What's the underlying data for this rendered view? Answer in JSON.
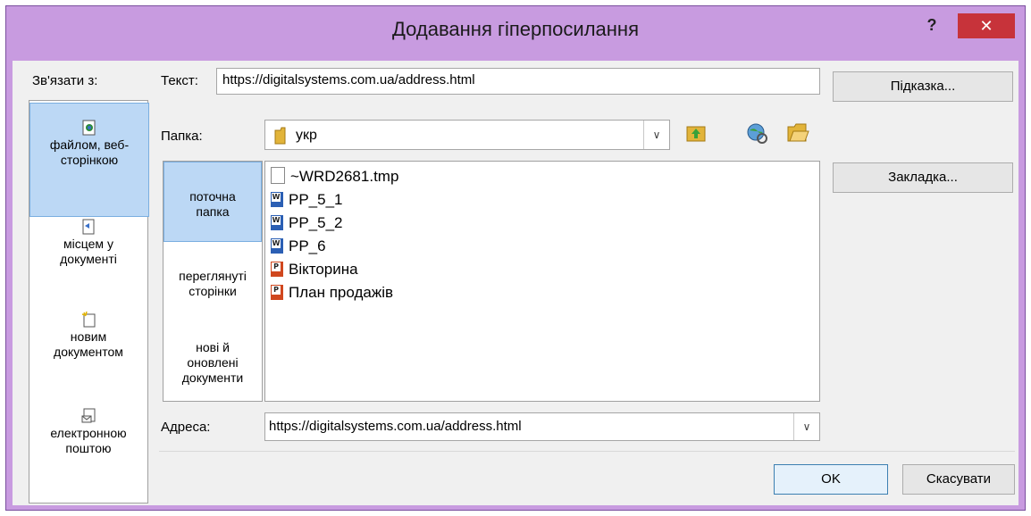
{
  "window": {
    "title": "Додавання гіперпосилання",
    "help_label": "?",
    "close_label": "✕"
  },
  "link_to": {
    "label": "Зв'язати з:",
    "items": [
      {
        "line1": "файлом, веб-",
        "line2": "сторінкою",
        "icon": "file-web-icon",
        "selected": true
      },
      {
        "line1": "місцем у",
        "line2": "документі",
        "icon": "place-in-document-icon",
        "selected": false
      },
      {
        "line1": "новим",
        "line2": "документом",
        "icon": "new-document-icon",
        "selected": false
      },
      {
        "line1": "електронною",
        "line2": "поштою",
        "icon": "email-icon",
        "selected": false
      }
    ]
  },
  "text_field": {
    "label": "Текст:",
    "value": "https://digitalsystems.com.ua/address.html"
  },
  "screentip_button": "Підказка...",
  "folder": {
    "label": "Папка:",
    "value": "укр"
  },
  "places": [
    {
      "line1": "поточна",
      "line2": "папка",
      "line3": "",
      "selected": true
    },
    {
      "line1": "переглянуті",
      "line2": "сторінки",
      "line3": "",
      "selected": false
    },
    {
      "line1": "нові й",
      "line2": "оновлені",
      "line3": "документи",
      "selected": false
    }
  ],
  "files": [
    {
      "name": "~WRD2681.tmp",
      "type": "blank"
    },
    {
      "name": "PP_5_1",
      "type": "word"
    },
    {
      "name": "PP_5_2",
      "type": "word"
    },
    {
      "name": "PP_6",
      "type": "word"
    },
    {
      "name": "Вікторина",
      "type": "powerpoint"
    },
    {
      "name": "План продажів",
      "type": "powerpoint"
    }
  ],
  "bookmark_button": "Закладка...",
  "address": {
    "label": "Адреса:",
    "value": "https://digitalsystems.com.ua/address.html"
  },
  "ok_button": "OK",
  "cancel_button": "Скасувати",
  "colors": {
    "title_bar": "#c89be0",
    "close_button": "#c7333a",
    "selection": "#bcd8f5"
  }
}
